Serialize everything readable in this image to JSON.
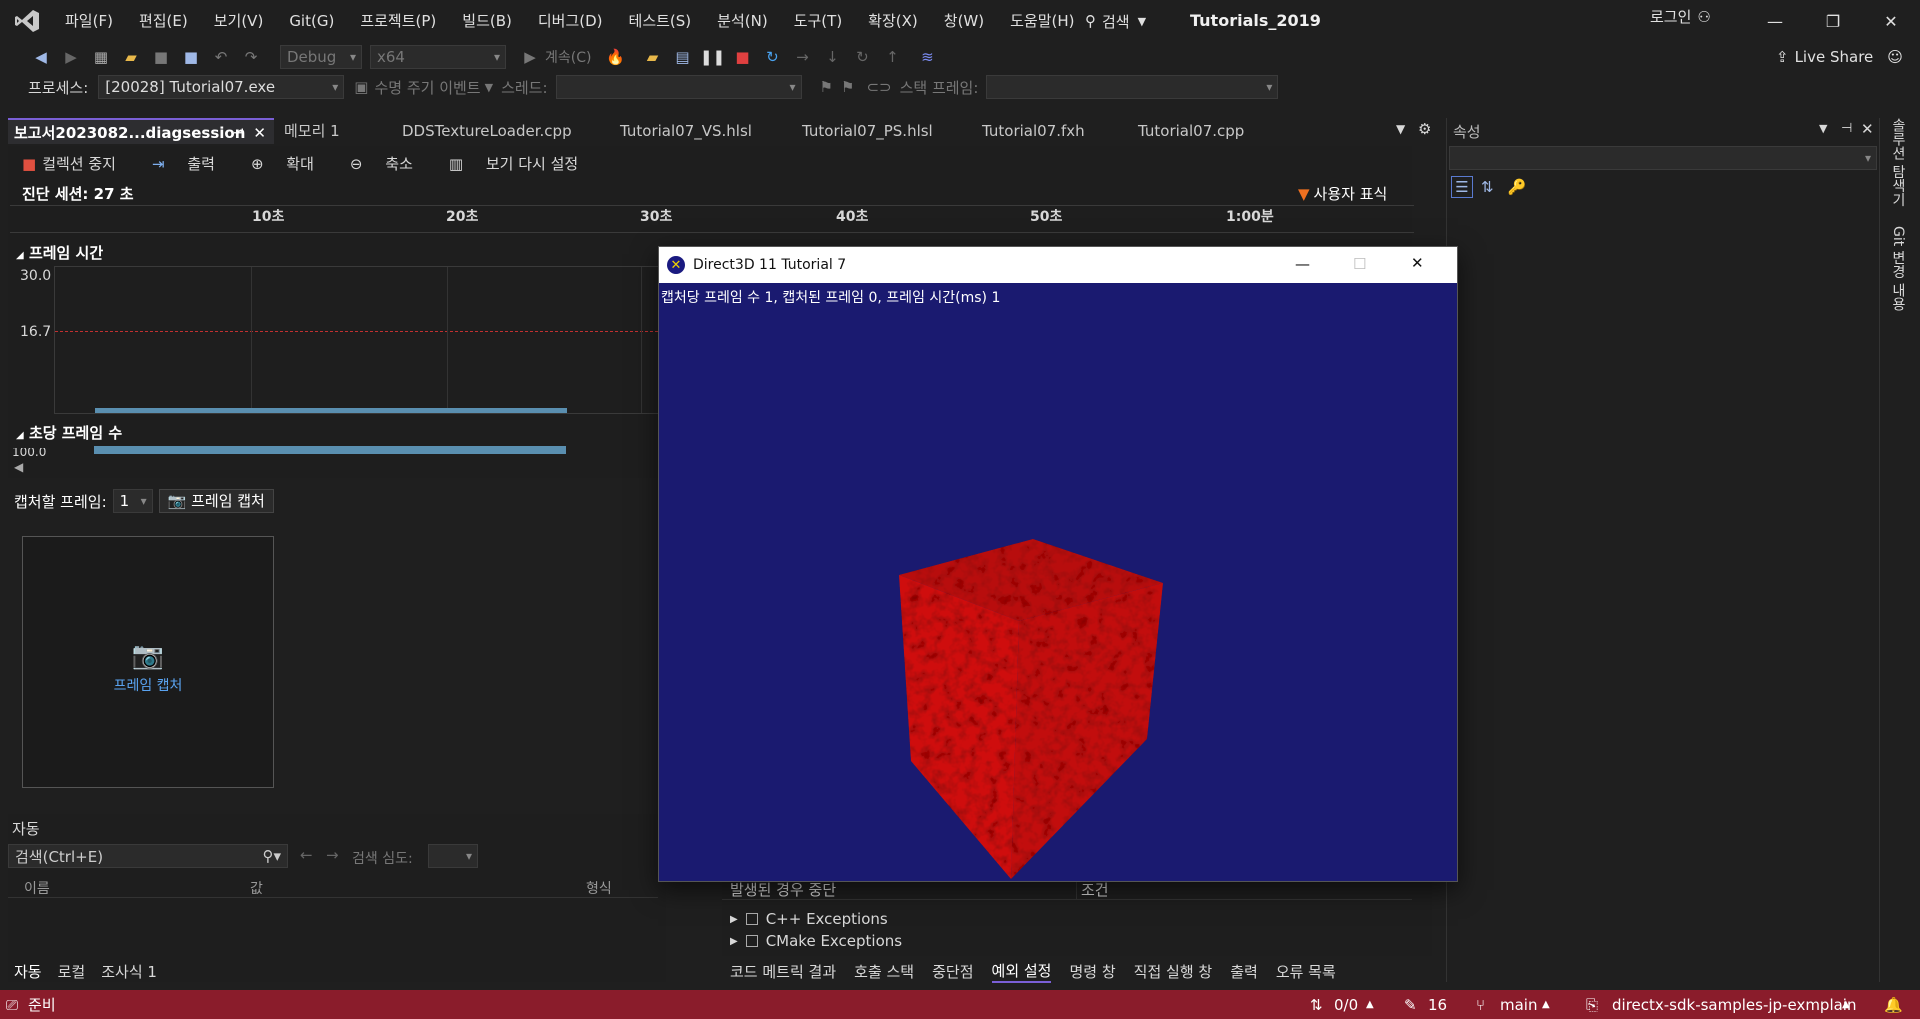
{
  "menu": [
    "파일(F)",
    "편집(E)",
    "보기(V)",
    "Git(G)",
    "프로젝트(P)",
    "빌드(B)",
    "디버그(D)",
    "테스트(S)",
    "분석(N)",
    "도구(T)",
    "확장(X)",
    "창(W)",
    "도움말(H)"
  ],
  "search": {
    "label": "검색"
  },
  "solution_name": "Tutorials_2019",
  "login": "로그인",
  "toolbar": {
    "config": "Debug",
    "platform": "x64",
    "continue": "계속(C)",
    "live_share": "Live Share"
  },
  "toolbar2": {
    "process_label": "프로세스:",
    "process_value": "[20028] Tutorial07.exe",
    "lifecycle": "수명 주기 이벤트",
    "thread": "스레드:",
    "stack_frame": "스택 프레임:"
  },
  "tabs": [
    "보고서2023082...diagsession",
    "메모리 1",
    "DDSTextureLoader.cpp",
    "Tutorial07_VS.hlsl",
    "Tutorial07_PS.hlsl",
    "Tutorial07.fxh",
    "Tutorial07.cpp"
  ],
  "diag": {
    "stop": "컬렉션 중지",
    "output": "출력",
    "zoom_in": "확대",
    "zoom_out": "축소",
    "reset_view": "보기 다시 설정",
    "session": "진단 세션: 27 초",
    "user_marks": "사용자 표식",
    "ticks": [
      "10초",
      "20초",
      "30초",
      "40초",
      "50초",
      "1:00분"
    ],
    "frame_time": "프레임 시간",
    "fps": "초당 프레임 수",
    "y30": "30.0",
    "y167": "16.7",
    "y100": "100.0"
  },
  "capture": {
    "label": "캡처할 프레임:",
    "count": "1",
    "button": "프레임 캡처",
    "box_label": "프레임 캡처"
  },
  "autos": {
    "title": "자동",
    "search_placeholder": "검색(Ctrl+E)",
    "depth": "검색 심도:",
    "col_name": "이름",
    "col_value": "값",
    "col_type": "형식",
    "tabs": [
      "자동",
      "로컬",
      "조사식 1"
    ]
  },
  "exceptions": {
    "col_break": "발생된 경우 중단",
    "col_cond": "조건",
    "items": [
      "C++ Exceptions",
      "CMake Exceptions"
    ],
    "tabs": [
      "코드 메트릭 결과",
      "호출 스택",
      "중단점",
      "예외 설정",
      "명령 창",
      "직접 실행 창",
      "출력",
      "오류 목록"
    ]
  },
  "properties": {
    "title": "속성"
  },
  "vert_tabs": [
    "솔루션 탐색기",
    "Git 변경 내용"
  ],
  "dxwin": {
    "title": "Direct3D 11 Tutorial 7",
    "overlay": "캡처당 프레임 수 1, 캡처된 프레임 0, 프레임 시간(ms) 1"
  },
  "status": {
    "ready": "준비",
    "sync": "0/0",
    "edits": "16",
    "branch": "main",
    "repo": "directx-sdk-samples-jp-exmplain"
  },
  "colors": {
    "status_bar": "#8a1c2b",
    "dx_bg": "#1a1a70",
    "cube": "#c41010",
    "accent": "#7a5fd6"
  }
}
